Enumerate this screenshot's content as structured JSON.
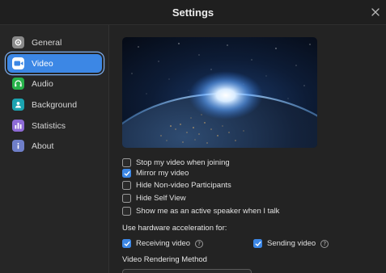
{
  "window": {
    "title": "Settings"
  },
  "sidebar": {
    "items": [
      {
        "label": "General",
        "icon": "gear-icon",
        "color": "#8a8a8a",
        "active": false
      },
      {
        "label": "Video",
        "icon": "video-camera-icon",
        "color": "#ffffff",
        "active": true
      },
      {
        "label": "Audio",
        "icon": "headphones-icon",
        "color": "#27b24a",
        "active": false
      },
      {
        "label": "Background",
        "icon": "person-background-icon",
        "color": "#1ba3b0",
        "active": false
      },
      {
        "label": "Statistics",
        "icon": "bar-chart-icon",
        "color": "#8e6bd6",
        "active": false
      },
      {
        "label": "About",
        "icon": "info-icon",
        "color": "#6f7fc9",
        "active": false
      }
    ]
  },
  "video": {
    "options": [
      {
        "label": "Stop my video when joining",
        "checked": false
      },
      {
        "label": "Mirror my video",
        "checked": true
      },
      {
        "label": "Hide Non-video Participants",
        "checked": false
      },
      {
        "label": "Hide Self View",
        "checked": false
      },
      {
        "label": "Show me as an active speaker when I talk",
        "checked": false
      }
    ],
    "hw_accel_label": "Use hardware acceleration for:",
    "hw_receiving": {
      "label": "Receiving video",
      "checked": true
    },
    "hw_sending": {
      "label": "Sending video",
      "checked": true
    },
    "rendering_label": "Video Rendering Method"
  },
  "colors": {
    "accent": "#3c87e5",
    "background": "#232323",
    "sidebar": "#262626"
  }
}
